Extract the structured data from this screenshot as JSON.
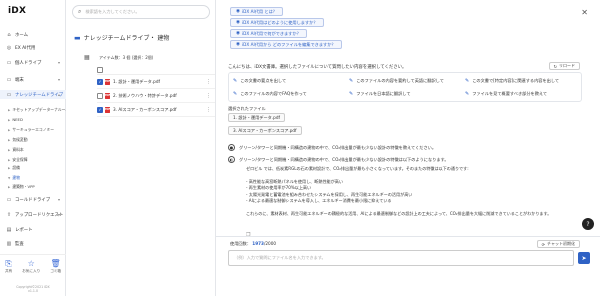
{
  "sidebar": {
    "logo": "iDX",
    "items": [
      {
        "label": "ホーム",
        "icon": "home-icon",
        "glyph": "⌂"
      },
      {
        "label": "EX AI代用",
        "icon": "chat-icon",
        "glyph": "◎"
      },
      {
        "label": "個人ドライブ",
        "icon": "folder-icon",
        "glyph": "▭"
      },
      {
        "label": "端末",
        "icon": "device-icon",
        "glyph": "▭"
      },
      {
        "label": "ナレッジチームドライブ",
        "icon": "team-folder-icon",
        "glyph": "▭"
      }
    ],
    "sub_items": [
      {
        "label": "キセットアップデーターナルーム"
      },
      {
        "label": "NEED"
      },
      {
        "label": "サーキュラーエコノミー"
      },
      {
        "label": "気候変動"
      },
      {
        "label": "資料本"
      },
      {
        "label": "安全保障"
      },
      {
        "label": "設備"
      },
      {
        "label": "建物",
        "selected": true
      },
      {
        "label": "建築物・VPP"
      }
    ],
    "items2": [
      {
        "label": "コールドドライブ",
        "icon": "cold-drive-icon",
        "glyph": "▭"
      },
      {
        "label": "アップロードリクエスト",
        "icon": "upload-icon",
        "glyph": "⇪"
      },
      {
        "label": "レポート",
        "icon": "report-icon",
        "glyph": "▤"
      },
      {
        "label": "監査",
        "icon": "audit-icon",
        "glyph": "▥"
      }
    ],
    "bottom_buttons": [
      {
        "label": "共有",
        "glyph": "⎘"
      },
      {
        "label": "お気に入り",
        "glyph": "☆"
      },
      {
        "label": "ゴミ箱",
        "glyph": "🗑"
      }
    ],
    "copyright": "Copyright©2021 iDX",
    "version": "v1.1.0"
  },
  "file_pane": {
    "search_placeholder": "検索語を入力してください。",
    "breadcrumb": "ナレッジチームドライブ・ 建物",
    "info": "アイテム数：3 個 (選択：2個)",
    "files": [
      {
        "name": "1. 設計・運用データ.pdf",
        "checked": true
      },
      {
        "name": "2. 技術ノウハウ・特許データ.pdf",
        "checked": false
      },
      {
        "name": "3. AIスコア・カーボンスコア.pdf",
        "checked": true
      }
    ]
  },
  "chat": {
    "suggestions": [
      "iDX AI代用 とは？",
      "iDX AI代用はどのように使用しますか？",
      "iDX AI代用で何ができますか？",
      "iDX AI代用から どのファイルを編集できますか？"
    ],
    "greeting": "こんにちは、iDX文書庫。選択したファイルについて質問したい内容を選択してください。",
    "reload_label": "リロード",
    "actions": [
      "この文書の要点を出して",
      "このファイルの内容を要約して英語に翻訳して",
      "この文書で[特定内容]に関連する内容を出して",
      "このファイルの内容でFAQを作って",
      "ファイルを日本語に翻訳して",
      "ファイルを見て概要すべき部分を教えて"
    ],
    "selected_label": "選択されたファイル",
    "selected_files": [
      "1. 設計・運用データ.pdf",
      "3. AIスコア・カーボンスコア.pdf"
    ],
    "user_question": "グリーン/タワーと同期機・同構造の建物の中で、CO₂排出量が最も少ない設計の特徴を教えてください。",
    "assistant_heading": "グリーン/タワーと同期機・同構造の建物の中で、CO₂排出量が最も少ない設計の特徴は以下のようになります。",
    "answer": [
      "ゼロビル では、低炭素RGLの石の素材設計で、CO₂排出量が最も小さくなっています。そのまたの特徴は以下の通りです:",
      "",
      "- 高性能な高窓断熱パネルを使用し、断熱性能が高い",
      "- 再生素材の使用率が70%以上高い",
      "- 太陽光発電と蓄電池を組み合わせたシステムを採用し、再生可能エネルギーの活用が高い",
      "- AIによる最適な制御システムを導入し、エネルギー消費を最小限に抑えている",
      "",
      "これらのに、素材表材、再生可能エネルギーの積極的な活用、AIによる最適制御などの設計上の工夫によって、CO₂排出量を大幅に削減できていることがわかります。"
    ],
    "counter_label": "使用回数：",
    "counter_used": "1973",
    "counter_total": "/2000",
    "reset_label": "チャット初期化",
    "input_placeholder": "（例）入力で質問にファイル名を入力できます。"
  }
}
